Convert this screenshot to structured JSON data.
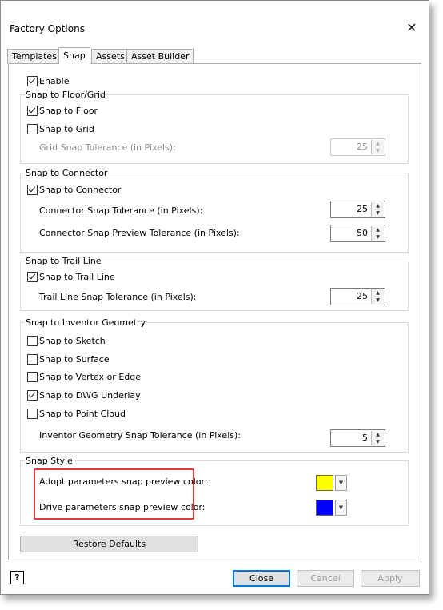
{
  "window": {
    "title": "Factory Options",
    "close_icon": "close-icon"
  },
  "tabs": [
    {
      "label": "Templates",
      "active": false
    },
    {
      "label": "Snap",
      "active": true
    },
    {
      "label": "Assets",
      "active": false
    },
    {
      "label": "Asset Builder",
      "active": false
    }
  ],
  "enable": {
    "label": "Enable",
    "checked": true
  },
  "floor_grid": {
    "legend": "Snap to Floor/Grid",
    "snap_floor": {
      "label": "Snap to Floor",
      "checked": true
    },
    "snap_grid": {
      "label": "Snap to Grid",
      "checked": false
    },
    "grid_tolerance": {
      "label": "Grid Snap Tolerance (in Pixels):",
      "value": "25",
      "enabled": false
    }
  },
  "connector": {
    "legend": "Snap to Connector",
    "snap_connector": {
      "label": "Snap to Connector",
      "checked": true
    },
    "tolerance": {
      "label": "Connector Snap Tolerance (in Pixels):",
      "value": "25"
    },
    "preview_tolerance": {
      "label": "Connector Snap Preview Tolerance (in Pixels):",
      "value": "50"
    }
  },
  "trail_line": {
    "legend": "Snap to Trail Line",
    "snap_trail": {
      "label": "Snap to Trail Line",
      "checked": true
    },
    "tolerance": {
      "label": "Trail Line Snap Tolerance (in Pixels):",
      "value": "25"
    }
  },
  "inventor": {
    "legend": "Snap to Inventor Geometry",
    "items": [
      {
        "label": "Snap to Sketch",
        "checked": false
      },
      {
        "label": "Snap to Surface",
        "checked": false
      },
      {
        "label": "Snap to Vertex or Edge",
        "checked": false
      },
      {
        "label": "Snap to DWG Underlay",
        "checked": true
      },
      {
        "label": "Snap to Point Cloud",
        "checked": false
      }
    ],
    "tolerance": {
      "label": "Inventor Geometry Snap Tolerance (in Pixels):",
      "value": "5"
    }
  },
  "snap_style": {
    "legend": "Snap Style",
    "adopt": {
      "label": "Adopt parameters snap preview color:",
      "color": "#ffff00"
    },
    "drive": {
      "label": "Drive parameters snap preview color:",
      "color": "#0000ff"
    },
    "highlight_color": "#e03b3b"
  },
  "buttons": {
    "restore": "Restore Defaults",
    "close": "Close",
    "cancel": "Cancel",
    "apply": "Apply"
  },
  "help": {
    "icon": "help-icon",
    "glyph": "?"
  }
}
